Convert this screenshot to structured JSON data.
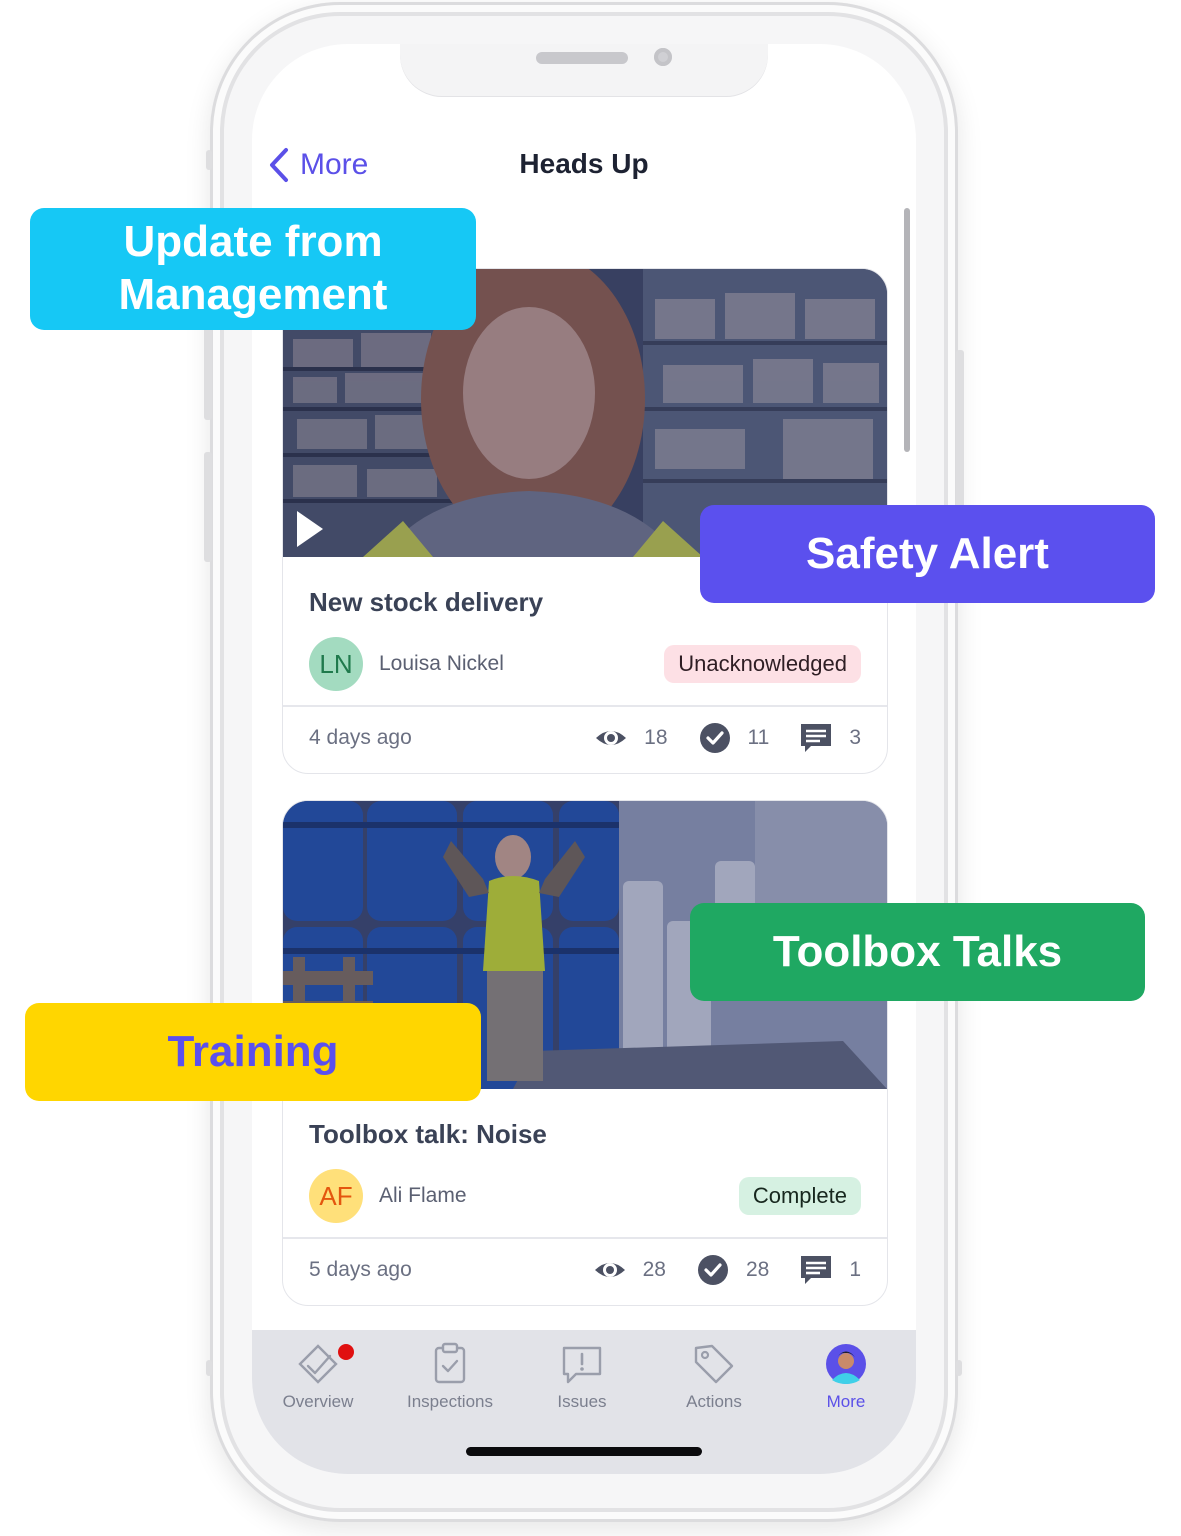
{
  "header": {
    "back_label": "More",
    "title": "Heads Up"
  },
  "cards": [
    {
      "title": "New stock delivery",
      "author_initials": "LN",
      "author_name": "Louisa Nickel",
      "status": "Unacknowledged",
      "time": "4 days ago",
      "views": "18",
      "acknowledged": "11",
      "comments": "3"
    },
    {
      "title": "Toolbox talk: Noise",
      "author_initials": "AF",
      "author_name": "Ali Flame",
      "status": "Complete",
      "time": "5 days ago",
      "views": "28",
      "acknowledged": "28",
      "comments": "1"
    }
  ],
  "tabs": [
    {
      "label": "Overview",
      "icon": "overview-icon"
    },
    {
      "label": "Inspections",
      "icon": "clipboard-icon"
    },
    {
      "label": "Issues",
      "icon": "issue-icon"
    },
    {
      "label": "Actions",
      "icon": "tag-icon"
    },
    {
      "label": "More",
      "icon": "avatar-icon"
    }
  ],
  "overlays": {
    "management": "Update from Management",
    "safety": "Safety Alert",
    "toolbox": "Toolbox Talks",
    "training": "Training"
  },
  "colors": {
    "accent": "#5b50e8",
    "overlay_management": "#16c8f5",
    "overlay_safety": "#5b50ee",
    "overlay_toolbox": "#1fa862",
    "overlay_training": "#ffd600",
    "badge_unacknowledged_bg": "#fde0e5",
    "badge_complete_bg": "#d6f1e2"
  }
}
